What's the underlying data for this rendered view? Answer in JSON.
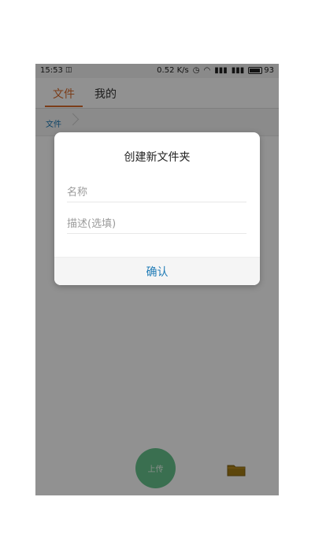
{
  "status": {
    "time": "15:53",
    "network_speed": "0.52 K/s",
    "battery": "93",
    "battery_level": 0.93
  },
  "tabs": [
    {
      "label": "文件",
      "active": true
    },
    {
      "label": "我的",
      "active": false
    }
  ],
  "breadcrumb": {
    "current": "文件"
  },
  "dialog": {
    "title": "创建新文件夹",
    "name_placeholder": "名称",
    "description_placeholder": "描述(选填)",
    "confirm_label": "确认"
  },
  "actions": {
    "upload_label": "上传"
  },
  "colors": {
    "accent": "#d86c2d",
    "link": "#1f7bb6",
    "upload": "#0aa14a"
  },
  "icons": {
    "folder": "folder-icon",
    "alarm": "alarm-icon",
    "wifi": "wifi-icon",
    "signal": "signal-icon",
    "battery": "battery-icon"
  }
}
